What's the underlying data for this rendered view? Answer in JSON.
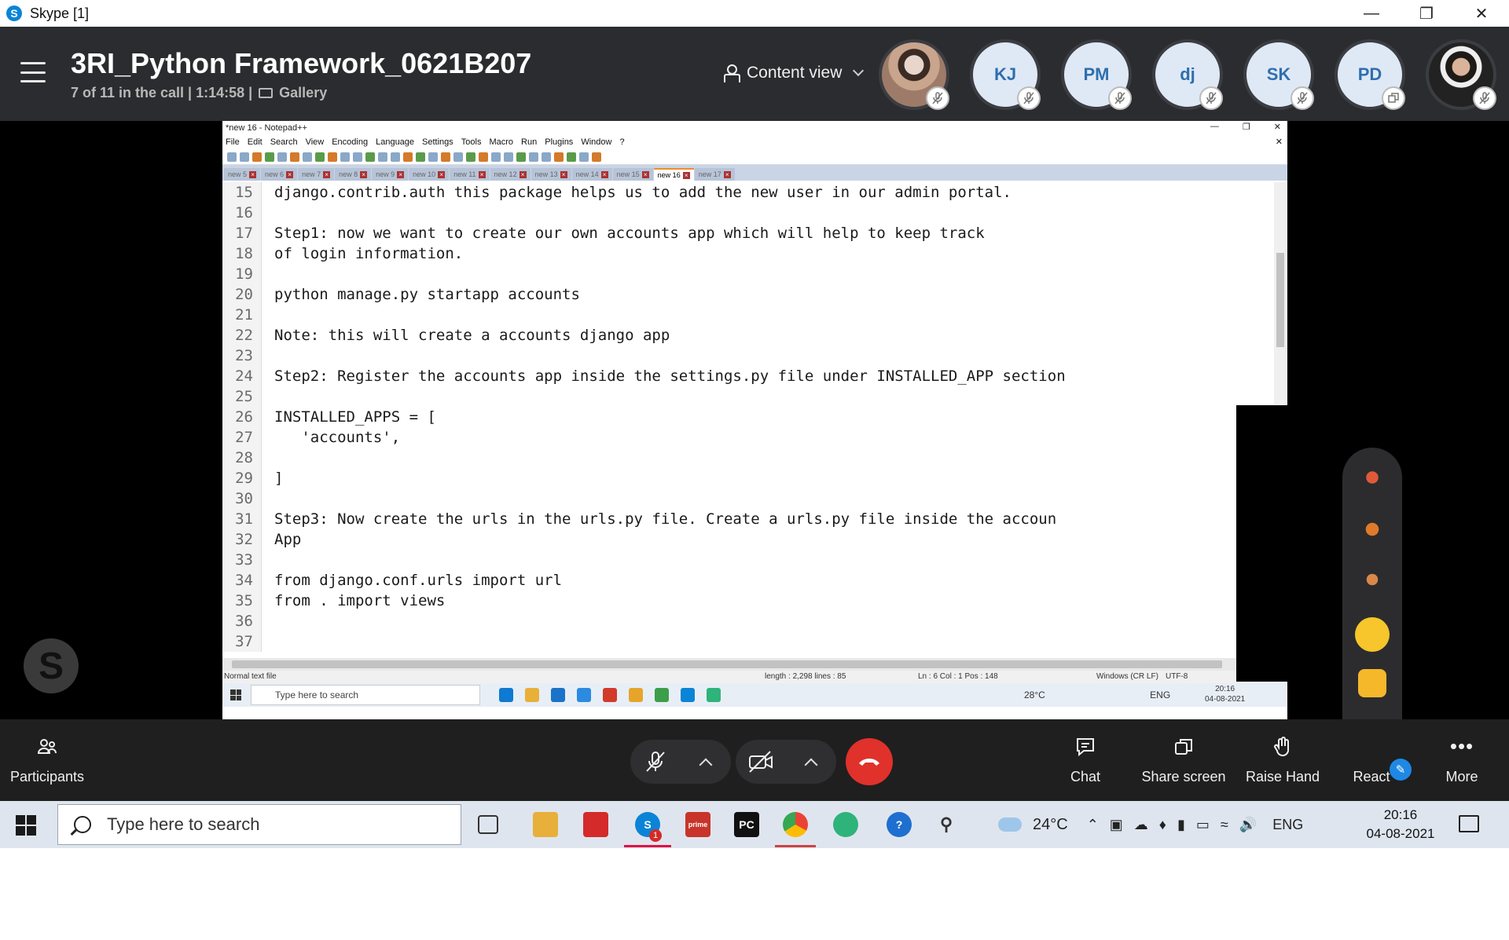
{
  "window": {
    "title": "Skype [1]",
    "icon_letter": "S"
  },
  "call": {
    "title": "3RI_Python Framework_0621B207",
    "status": "7 of 11 in the call | 1:14:58 |",
    "view_mode": "Gallery",
    "content_view_label": "Content view"
  },
  "participants": [
    {
      "initials": "",
      "kind": "photo",
      "badge": "mic-muted-icon"
    },
    {
      "initials": "KJ",
      "kind": "initials",
      "badge": "mic-muted-icon"
    },
    {
      "initials": "PM",
      "kind": "initials",
      "badge": "mic-muted-icon"
    },
    {
      "initials": "dj",
      "kind": "initials",
      "badge": "mic-muted-icon"
    },
    {
      "initials": "SK",
      "kind": "initials",
      "badge": "mic-muted-icon"
    },
    {
      "initials": "PD",
      "kind": "initials",
      "badge": "screen-share-icon"
    },
    {
      "initials": "",
      "kind": "photo",
      "badge": "mic-muted-icon"
    }
  ],
  "notepad": {
    "title": "*new 16 - Notepad++",
    "menu": [
      "File",
      "Edit",
      "Search",
      "View",
      "Encoding",
      "Language",
      "Settings",
      "Tools",
      "Macro",
      "Run",
      "Plugins",
      "Window",
      "?"
    ],
    "tabs": [
      "new 5",
      "new 6",
      "new 7",
      "new 8",
      "new 9",
      "new 10",
      "new 11",
      "new 12",
      "new 13",
      "new 14",
      "new 15",
      "new 16",
      "new 17"
    ],
    "active_tab": "new 16",
    "lines": [
      {
        "n": "15",
        "text": "django.contrib.auth this package helps us to add the new user in our admin portal."
      },
      {
        "n": "16",
        "text": ""
      },
      {
        "n": "17",
        "text": "Step1: now we want to create our own accounts app which will help to keep track"
      },
      {
        "n": "18",
        "text": "of login information."
      },
      {
        "n": "19",
        "text": ""
      },
      {
        "n": "20",
        "text": "python manage.py startapp accounts"
      },
      {
        "n": "21",
        "text": ""
      },
      {
        "n": "22",
        "text": "Note: this will create a accounts django app"
      },
      {
        "n": "23",
        "text": ""
      },
      {
        "n": "24",
        "text": "Step2: Register the accounts app inside the settings.py file under INSTALLED_APP section"
      },
      {
        "n": "25",
        "text": ""
      },
      {
        "n": "26",
        "text": "INSTALLED_APPS = ["
      },
      {
        "n": "27",
        "text": "   'accounts',"
      },
      {
        "n": "28",
        "text": ""
      },
      {
        "n": "29",
        "text": "]"
      },
      {
        "n": "30",
        "text": ""
      },
      {
        "n": "31",
        "text": "Step3: Now create the urls in the urls.py file. Create a urls.py file inside the accoun"
      },
      {
        "n": "32",
        "text": "App"
      },
      {
        "n": "33",
        "text": ""
      },
      {
        "n": "34",
        "text": "from django.conf.urls import url"
      },
      {
        "n": "35",
        "text": "from . import views"
      },
      {
        "n": "36",
        "text": ""
      },
      {
        "n": "37",
        "text": ""
      }
    ],
    "status": {
      "type": "Normal text file",
      "length": "length : 2,298    lines : 85",
      "position": "Ln : 6    Col : 1    Pos : 148",
      "eol": "Windows (CR LF)",
      "encoding": "UTF-8"
    },
    "inner_taskbar": {
      "search_placeholder": "Type here to search",
      "weather": "28°C",
      "lang": "ENG",
      "time": "20:16",
      "date": "04-08-2021"
    }
  },
  "controls": {
    "participants_label": "Participants",
    "chat_label": "Chat",
    "share_label": "Share screen",
    "raise_hand_label": "Raise Hand",
    "react_label": "React",
    "more_label": "More"
  },
  "reactions": [
    "dancing-figure",
    "celebrating-figure",
    "juggling-figure",
    "surprised-face",
    "thumbs-up",
    "heart"
  ],
  "taskbar": {
    "search_placeholder": "Type here to search",
    "weather_temp": "24°C",
    "language": "ENG",
    "time": "20:16",
    "date": "04-08-2021",
    "skype_badge": "1"
  },
  "colors": {
    "header_bg": "#2b2c2f",
    "end_call": "#e0312b",
    "skype_blue": "#0a84d6",
    "accent_orange": "#f28c28"
  }
}
